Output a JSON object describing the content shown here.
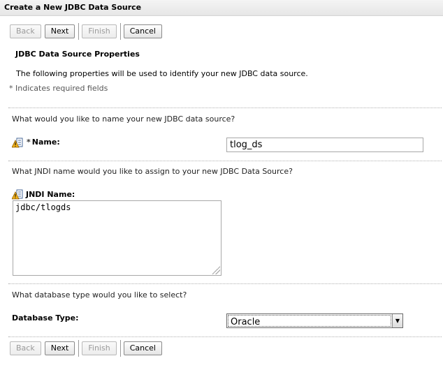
{
  "window": {
    "title": "Create a New JDBC Data Source"
  },
  "buttons": {
    "back": "Back",
    "next": "Next",
    "finish": "Finish",
    "cancel": "Cancel"
  },
  "section": {
    "heading": "JDBC Data Source Properties",
    "description": "The following properties will be used to identify your new JDBC data source.",
    "required_note": "* Indicates required fields"
  },
  "name_field": {
    "question": "What would you like to name your new JDBC data source?",
    "required_marker": "*",
    "label": "Name:",
    "value": "tlog_ds"
  },
  "jndi_field": {
    "question": "What JNDI name would you like to assign to your new JDBC Data Source?",
    "label": "JNDI Name:",
    "value": "jdbc/tlogds"
  },
  "db_type_field": {
    "question": "What database type would you like to select?",
    "label": "Database Type:",
    "selected": "Oracle"
  },
  "icons": {
    "field_help": "help-warning-icon",
    "dropdown": "chevron-down-icon"
  }
}
